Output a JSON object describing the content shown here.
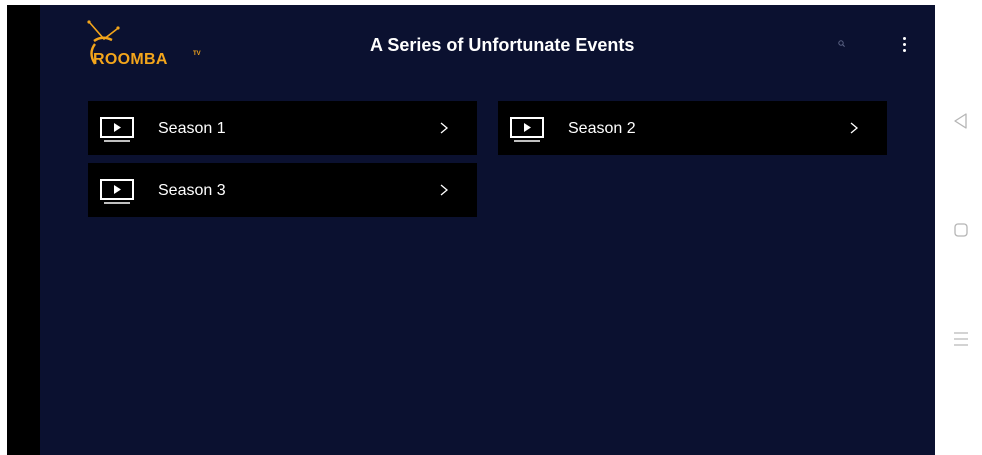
{
  "app": {
    "logo_text": "ROOMBA",
    "logo_superscript": "TV",
    "page_title": "A Series of Unfortunate Events"
  },
  "header": {
    "search_icon": "search-icon",
    "menu_icon": "more-vertical-icon"
  },
  "seasons": [
    {
      "label": "Season 1",
      "icon": "tv-play-icon"
    },
    {
      "label": "Season 2",
      "icon": "tv-play-icon"
    },
    {
      "label": "Season 3",
      "icon": "tv-play-icon"
    }
  ],
  "system_nav": {
    "back_icon": "back-triangle-icon",
    "home_icon": "home-square-icon",
    "recents_icon": "recents-menu-icon"
  },
  "colors": {
    "app_background": "#0b1130",
    "card_background": "#000000",
    "brand_accent": "#f3a51b",
    "text": "#ffffff"
  }
}
